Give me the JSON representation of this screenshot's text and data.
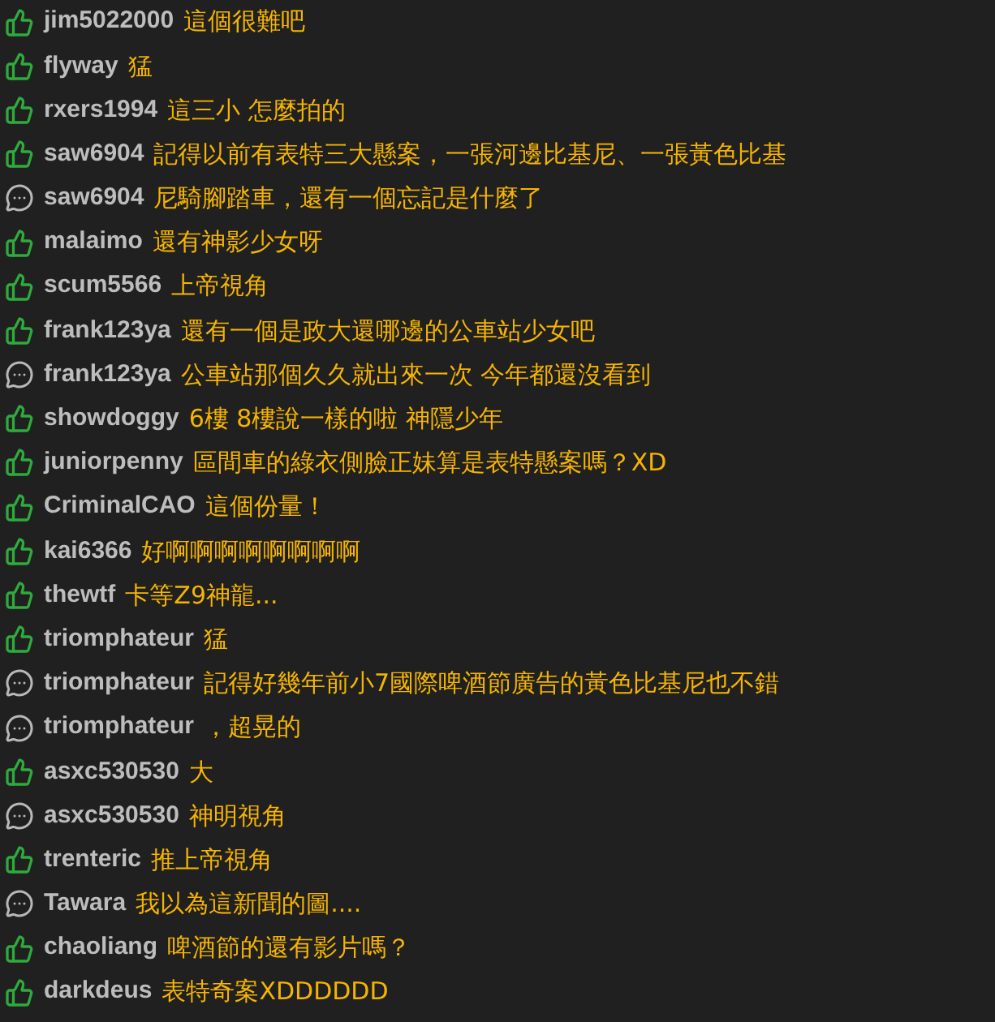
{
  "comments": [
    {
      "kind": "push",
      "user": "jim5022000",
      "text": "這個很難吧"
    },
    {
      "kind": "push",
      "user": "flyway",
      "text": "猛"
    },
    {
      "kind": "push",
      "user": "rxers1994",
      "text": "這三小 怎麼拍的"
    },
    {
      "kind": "push",
      "user": "saw6904",
      "text": "記得以前有表特三大懸案，一張河邊比基尼、一張黃色比基"
    },
    {
      "kind": "comment",
      "user": "saw6904",
      "text": "尼騎腳踏車，還有一個忘記是什麼了"
    },
    {
      "kind": "push",
      "user": "malaimo",
      "text": "還有神影少女呀"
    },
    {
      "kind": "push",
      "user": "scum5566",
      "text": "上帝視角"
    },
    {
      "kind": "push",
      "user": "frank123ya",
      "text": "還有一個是政大還哪邊的公車站少女吧"
    },
    {
      "kind": "comment",
      "user": "frank123ya",
      "text": "公車站那個久久就出來一次 今年都還沒看到"
    },
    {
      "kind": "push",
      "user": "showdoggy",
      "text": "6樓 8樓說一樣的啦 神隱少年"
    },
    {
      "kind": "push",
      "user": "juniorpenny",
      "text": "區間車的綠衣側臉正妹算是表特懸案嗎？XD"
    },
    {
      "kind": "push",
      "user": "CriminalCAO",
      "text": "這個份量！"
    },
    {
      "kind": "push",
      "user": "kai6366",
      "text": "好啊啊啊啊啊啊啊啊"
    },
    {
      "kind": "push",
      "user": "thewtf",
      "text": "卡等Z9神龍..."
    },
    {
      "kind": "push",
      "user": "triomphateur",
      "text": "猛"
    },
    {
      "kind": "comment",
      "user": "triomphateur",
      "text": "記得好幾年前小7國際啤酒節廣告的黃色比基尼也不錯"
    },
    {
      "kind": "comment",
      "user": "triomphateur",
      "text": "，超晃的"
    },
    {
      "kind": "push",
      "user": "asxc530530",
      "text": "大"
    },
    {
      "kind": "comment",
      "user": "asxc530530",
      "text": "神明視角"
    },
    {
      "kind": "push",
      "user": "trenteric",
      "text": "推上帝視角"
    },
    {
      "kind": "comment",
      "user": "Tawara",
      "text": "我以為這新聞的圖...."
    },
    {
      "kind": "push",
      "user": "chaoliang",
      "text": "啤酒節的還有影片嗎？"
    },
    {
      "kind": "push",
      "user": "darkdeus",
      "text": "表特奇案XDDDDDD"
    }
  ]
}
